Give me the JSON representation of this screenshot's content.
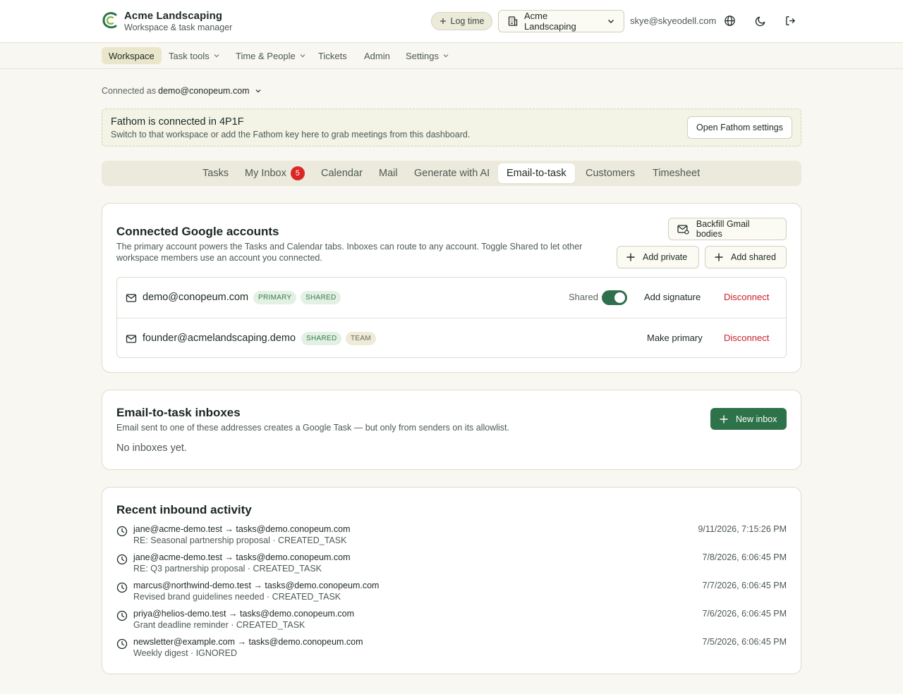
{
  "header": {
    "brand_name": "Acme Landscaping",
    "brand_sub": "Workspace & task manager",
    "log_time_label": "Log time",
    "workspace_selected": "Acme Landscaping",
    "user_email": "skye@skyeodell.com",
    "icons": [
      "plus-icon",
      "building-icon",
      "chevron-down-icon",
      "globe-icon",
      "moon-icon",
      "logout-icon"
    ]
  },
  "nav": {
    "items": [
      {
        "label": "Workspace",
        "active": true,
        "dropdown": false
      },
      {
        "label": "Task tools",
        "active": false,
        "dropdown": true
      },
      {
        "label": "Time & People",
        "active": false,
        "dropdown": true
      },
      {
        "label": "Tickets",
        "active": false,
        "dropdown": false
      },
      {
        "label": "Admin",
        "active": false,
        "dropdown": false
      },
      {
        "label": "Settings",
        "active": false,
        "dropdown": true
      }
    ]
  },
  "connected": {
    "prefix": "Connected as",
    "email": "demo@conopeum.com"
  },
  "fathom": {
    "title": "Fathom is connected in 4P1F",
    "description": "Switch to that workspace or add the Fathom key here to grab meetings from this dashboard.",
    "button_label": "Open Fathom settings"
  },
  "tabs": {
    "items": [
      {
        "label": "Tasks"
      },
      {
        "label": "My Inbox",
        "badge": "5"
      },
      {
        "label": "Calendar"
      },
      {
        "label": "Mail"
      },
      {
        "label": "Generate with AI"
      },
      {
        "label": "Email-to-task",
        "active": true
      },
      {
        "label": "Customers"
      },
      {
        "label": "Timesheet"
      }
    ]
  },
  "google_accounts": {
    "title": "Connected Google accounts",
    "description": "The primary account powers the Tasks and Calendar tabs. Inboxes can route to any account. Toggle Shared to let other workspace members use an account you connected.",
    "backfill_label": "Backfill Gmail bodies",
    "add_private_label": "Add private",
    "add_shared_label": "Add shared",
    "accounts": [
      {
        "email": "demo@conopeum.com",
        "badges": [
          "PRIMARY",
          "SHARED"
        ],
        "shared_label": "Shared",
        "shared_on": true,
        "action_label": "Add signature",
        "disconnect_label": "Disconnect"
      },
      {
        "email": "founder@acmelandscaping.demo",
        "badges": [
          "SHARED",
          "TEAM"
        ],
        "action_label": "Make primary",
        "disconnect_label": "Disconnect"
      }
    ]
  },
  "inboxes": {
    "title": "Email-to-task inboxes",
    "description": "Email sent to one of these addresses creates a Google Task — but only from senders on its allowlist.",
    "new_inbox_label": "New inbox",
    "empty_text": "No inboxes yet."
  },
  "activity": {
    "title": "Recent inbound activity",
    "items": [
      {
        "from": "jane@acme-demo.test",
        "arrow": "→",
        "to": "tasks@demo.conopeum.com",
        "detail": "RE: Seasonal partnership proposal · CREATED_TASK",
        "time": "9/11/2026, 7:15:26 PM"
      },
      {
        "from": "jane@acme-demo.test",
        "arrow": "→",
        "to": "tasks@demo.conopeum.com",
        "detail": "RE: Q3 partnership proposal · CREATED_TASK",
        "time": "7/8/2026, 6:06:45 PM"
      },
      {
        "from": "marcus@northwind-demo.test",
        "arrow": "→",
        "to": "tasks@demo.conopeum.com",
        "detail": "Revised brand guidelines needed · CREATED_TASK",
        "time": "7/7/2026, 6:06:45 PM"
      },
      {
        "from": "priya@helios-demo.test",
        "arrow": "→",
        "to": "tasks@demo.conopeum.com",
        "detail": "Grant deadline reminder · CREATED_TASK",
        "time": "7/6/2026, 6:06:45 PM"
      },
      {
        "from": "newsletter@example.com",
        "arrow": "→",
        "to": "tasks@demo.conopeum.com",
        "detail": "Weekly digest · IGNORED",
        "time": "7/5/2026, 6:06:45 PM"
      }
    ]
  },
  "colors": {
    "accent_green": "#2d7248",
    "danger_red": "#c8202a",
    "badge_red": "#dc2626",
    "background": "#f8f7f1"
  }
}
